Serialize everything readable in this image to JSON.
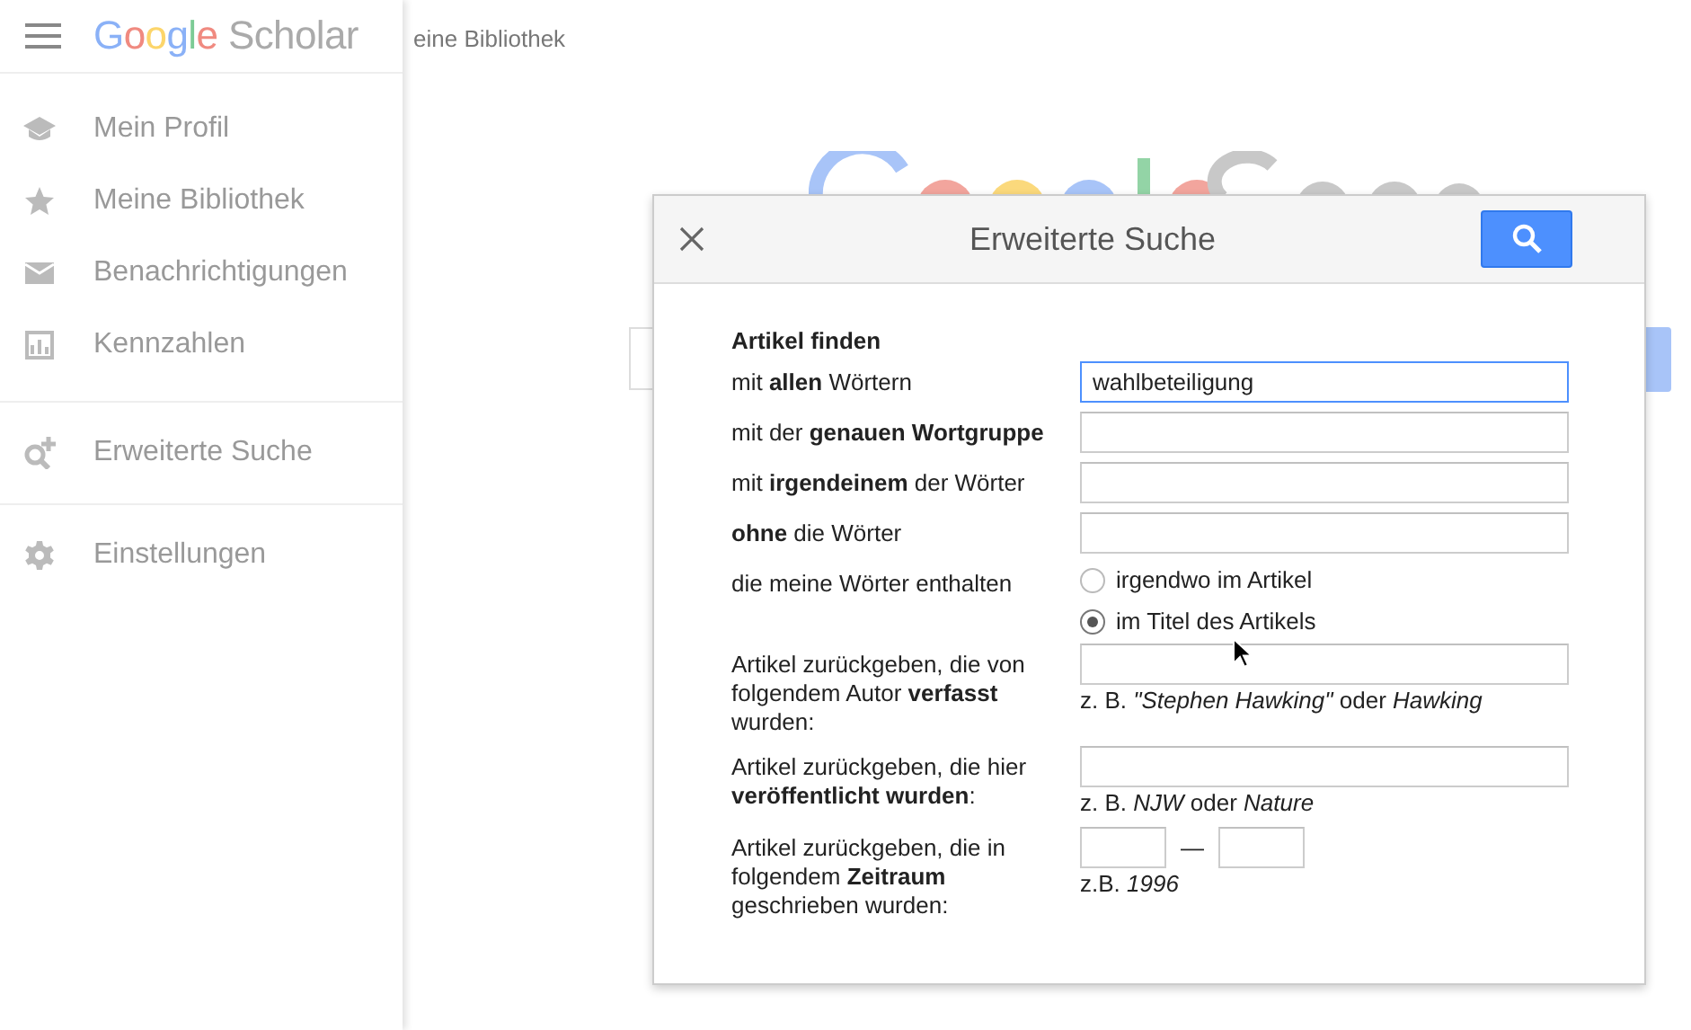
{
  "page": {
    "breadcrumb": "eine Bibliothek"
  },
  "sidebar": {
    "logo": {
      "brand": "Google",
      "product": "Scholar"
    },
    "groups": [
      {
        "items": [
          {
            "label": "Mein Profil"
          },
          {
            "label": "Meine Bibliothek"
          },
          {
            "label": "Benachrichtigungen"
          },
          {
            "label": "Kennzahlen"
          }
        ]
      },
      {
        "items": [
          {
            "label": "Erweiterte Suche"
          }
        ]
      },
      {
        "items": [
          {
            "label": "Einstellungen"
          }
        ]
      }
    ]
  },
  "dialog": {
    "title": "Erweiterte Suche",
    "section": "Artikel finden",
    "fields": [
      {
        "kind": "text",
        "label": "mit **allen** Wörtern",
        "value": "wahlbeteiligung",
        "focused": true
      },
      {
        "kind": "text",
        "label": "mit der **genauen Wortgruppe**",
        "focused": false
      },
      {
        "kind": "text",
        "label": "mit **irgendeinem** der Wörter",
        "focused": false
      },
      {
        "kind": "text",
        "label": "**ohne** die Wörter",
        "focused": false
      },
      {
        "kind": "radio",
        "label": "die meine Wörter enthalten",
        "options": [
          {
            "label": "irgendwo im Artikel",
            "selected": false
          },
          {
            "label": "im Titel des Artikels",
            "selected": true
          }
        ]
      },
      {
        "kind": "hinted",
        "label": "Artikel zurückgeben, die von folgendem Autor **verfasst** wurden:",
        "hint": "z. B. *\"Stephen Hawking\"* oder *Hawking*"
      },
      {
        "kind": "hinted",
        "label": "Artikel zurückgeben, die hier **veröffentlicht wurden**:",
        "hint": "z. B. *NJW* oder *Nature*"
      },
      {
        "kind": "range",
        "label": "Artikel zurückgeben, die in folgendem **Zeitraum** geschrieben wurden:",
        "separator": "—",
        "hint": "z.B. *1996*"
      }
    ]
  }
}
